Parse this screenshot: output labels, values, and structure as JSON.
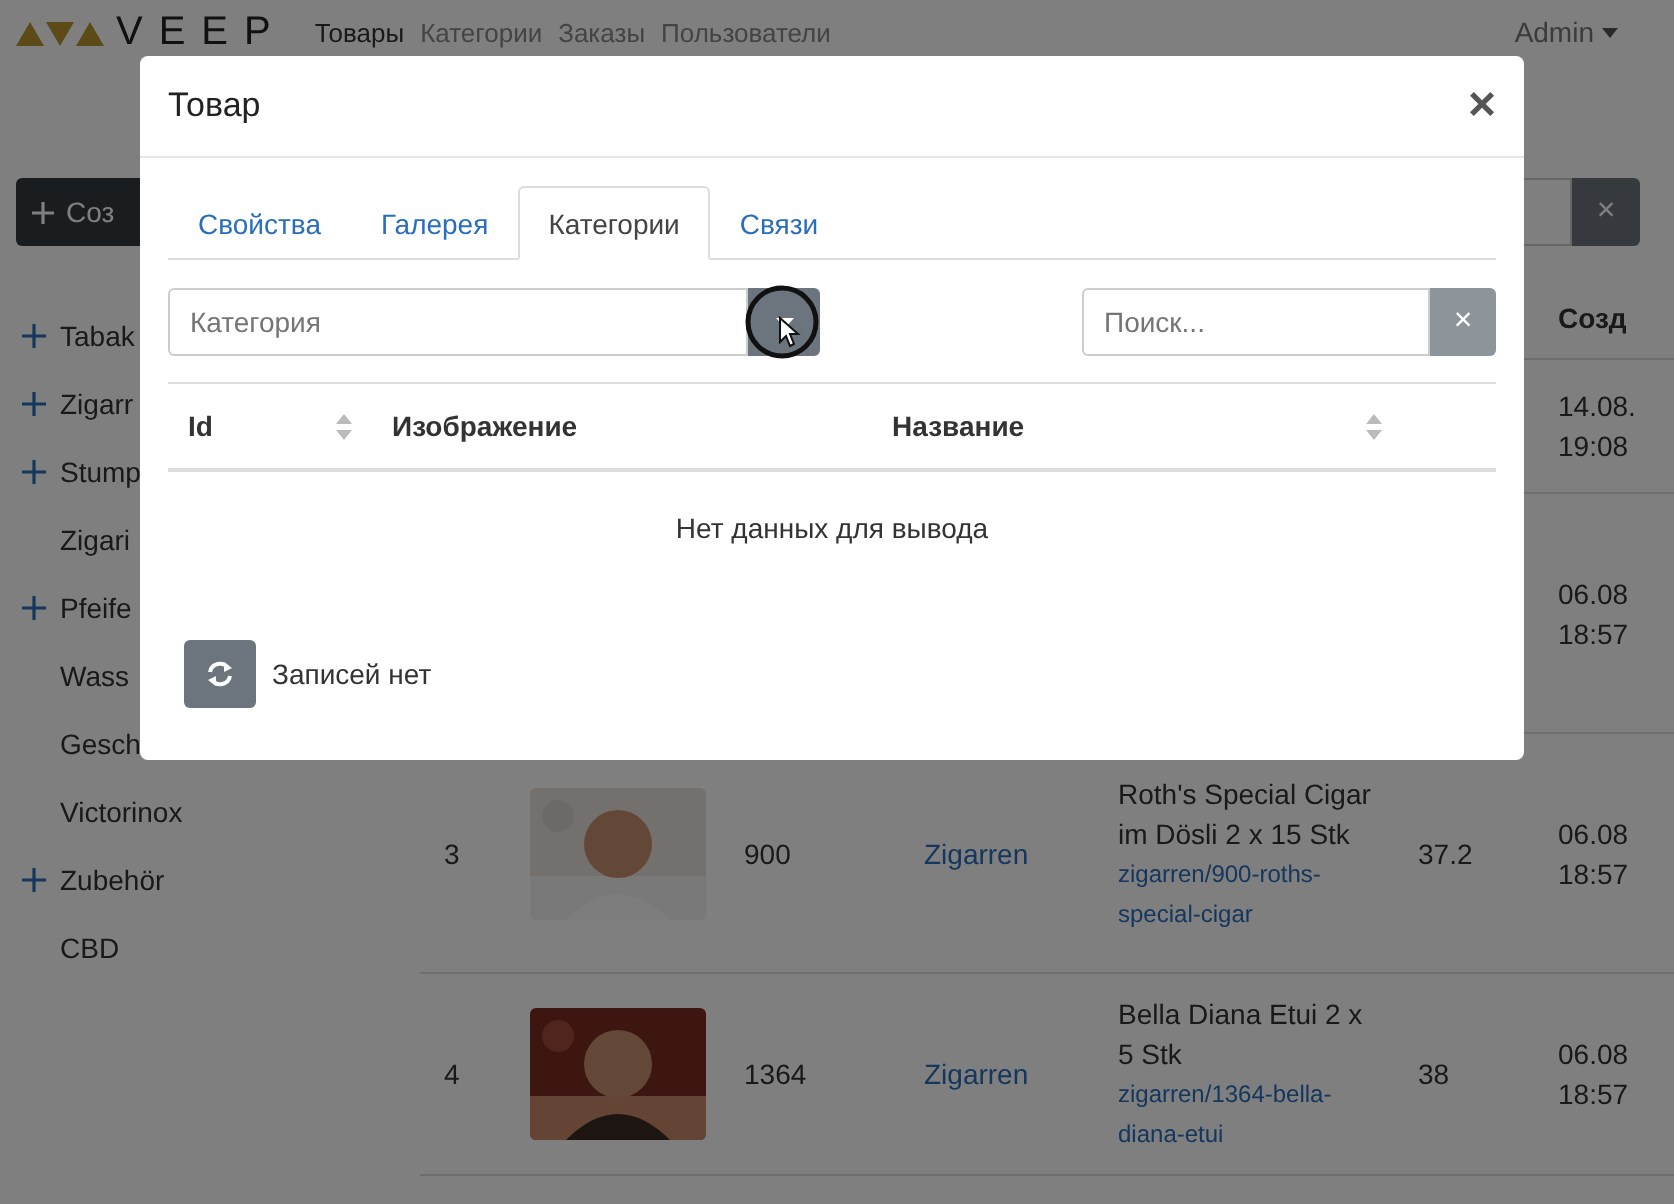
{
  "navbar": {
    "logo": "VEEP",
    "links": [
      {
        "label": "Товары",
        "selected": true
      },
      {
        "label": "Категории",
        "selected": false
      },
      {
        "label": "Заказы",
        "selected": false
      },
      {
        "label": "Пользователи",
        "selected": false
      }
    ],
    "user": "Admin"
  },
  "toolbar": {
    "create_button": "Соз",
    "clear_button": "×"
  },
  "sidebar": {
    "items": [
      {
        "label": "Tabak",
        "expandable": true
      },
      {
        "label": "Zigarr",
        "expandable": true
      },
      {
        "label": "Stump",
        "expandable": true
      },
      {
        "label": "Zigari",
        "expandable": false
      },
      {
        "label": "Pfeife",
        "expandable": true
      },
      {
        "label": "Wass",
        "expandable": false
      },
      {
        "label": "Gesch",
        "expandable": false
      },
      {
        "label": "Victorinox",
        "expandable": false
      },
      {
        "label": "Zubehör",
        "expandable": true
      },
      {
        "label": "CBD",
        "expandable": false
      }
    ]
  },
  "table": {
    "columns": [
      {
        "label": "Созд"
      }
    ],
    "rows": [
      {
        "date": "14.08.",
        "time": "19:08"
      },
      {
        "date": "06.08",
        "time": "18:57"
      },
      {
        "number": "3",
        "id": "900",
        "category": "Zigarren",
        "name": "Roth's Special Cigar im Dösli 2 x 15 Stk",
        "slug": "zigarren/900-roths-special-cigar",
        "price": "37.2",
        "date": "06.08",
        "time": "18:57"
      },
      {
        "number": "4",
        "id": "1364",
        "category": "Zigarren",
        "name": "Bella Diana Etui 2 x 5 Stk",
        "slug": "zigarren/1364-bella-diana-etui",
        "price": "38",
        "date": "06.08",
        "time": "18:57"
      }
    ]
  },
  "modal": {
    "title": "Товар",
    "close": "×",
    "tabs": [
      {
        "label": "Свойства",
        "selected": false
      },
      {
        "label": "Галерея",
        "selected": false
      },
      {
        "label": "Категории",
        "selected": true
      },
      {
        "label": "Связи",
        "selected": false
      }
    ],
    "category_select": {
      "placeholder": "Категория"
    },
    "search": {
      "placeholder": "Поиск...",
      "clear": "×"
    },
    "columns": [
      {
        "label": "Id",
        "sortable": true
      },
      {
        "label": "Изображение",
        "sortable": false
      },
      {
        "label": "Название",
        "sortable": true
      }
    ],
    "empty_text": "Нет данных для вывода",
    "footer": {
      "records": "Записей нет"
    }
  }
}
